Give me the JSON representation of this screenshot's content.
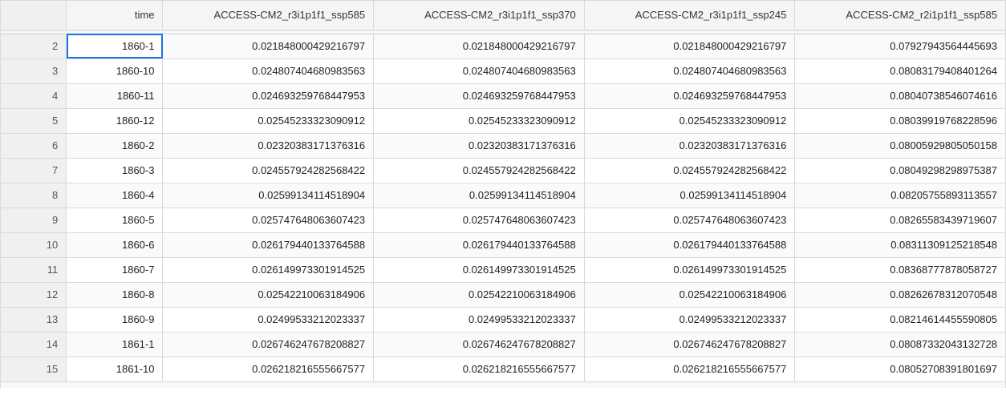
{
  "columns": {
    "rownum": "",
    "time": "time",
    "c1": "ACCESS-CM2_r3i1p1f1_ssp585",
    "c2": "ACCESS-CM2_r3i1p1f1_ssp370",
    "c3": "ACCESS-CM2_r3i1p1f1_ssp245",
    "c4": "ACCESS-CM2_r2i1p1f1_ssp585"
  },
  "selected_cell": {
    "row_index": 0,
    "col": "time"
  },
  "rows": [
    {
      "rownum": "2",
      "time": "1860-1",
      "c1": "0.021848000429216797",
      "c2": "0.021848000429216797",
      "c3": "0.021848000429216797",
      "c4": "0.07927943564445693"
    },
    {
      "rownum": "3",
      "time": "1860-10",
      "c1": "0.024807404680983563",
      "c2": "0.024807404680983563",
      "c3": "0.024807404680983563",
      "c4": "0.08083179408401264"
    },
    {
      "rownum": "4",
      "time": "1860-11",
      "c1": "0.024693259768447953",
      "c2": "0.024693259768447953",
      "c3": "0.024693259768447953",
      "c4": "0.08040738546074616"
    },
    {
      "rownum": "5",
      "time": "1860-12",
      "c1": "0.02545233323090912",
      "c2": "0.02545233323090912",
      "c3": "0.02545233323090912",
      "c4": "0.08039919768228596"
    },
    {
      "rownum": "6",
      "time": "1860-2",
      "c1": "0.02320383171376316",
      "c2": "0.02320383171376316",
      "c3": "0.02320383171376316",
      "c4": "0.08005929805050158"
    },
    {
      "rownum": "7",
      "time": "1860-3",
      "c1": "0.024557924282568422",
      "c2": "0.024557924282568422",
      "c3": "0.024557924282568422",
      "c4": "0.08049298298975387"
    },
    {
      "rownum": "8",
      "time": "1860-4",
      "c1": "0.02599134114518904",
      "c2": "0.02599134114518904",
      "c3": "0.02599134114518904",
      "c4": "0.08205755893113557"
    },
    {
      "rownum": "9",
      "time": "1860-5",
      "c1": "0.025747648063607423",
      "c2": "0.025747648063607423",
      "c3": "0.025747648063607423",
      "c4": "0.08265583439719607"
    },
    {
      "rownum": "10",
      "time": "1860-6",
      "c1": "0.026179440133764588",
      "c2": "0.026179440133764588",
      "c3": "0.026179440133764588",
      "c4": "0.08311309125218548"
    },
    {
      "rownum": "11",
      "time": "1860-7",
      "c1": "0.026149973301914525",
      "c2": "0.026149973301914525",
      "c3": "0.026149973301914525",
      "c4": "0.08368777878058727"
    },
    {
      "rownum": "12",
      "time": "1860-8",
      "c1": "0.02542210063184906",
      "c2": "0.02542210063184906",
      "c3": "0.02542210063184906",
      "c4": "0.08262678312070548"
    },
    {
      "rownum": "13",
      "time": "1860-9",
      "c1": "0.02499533212023337",
      "c2": "0.02499533212023337",
      "c3": "0.02499533212023337",
      "c4": "0.08214614455590805"
    },
    {
      "rownum": "14",
      "time": "1861-1",
      "c1": "0.026746247678208827",
      "c2": "0.026746247678208827",
      "c3": "0.026746247678208827",
      "c4": "0.08087332043132728"
    },
    {
      "rownum": "15",
      "time": "1861-10",
      "c1": "0.026218216555667577",
      "c2": "0.026218216555667577",
      "c3": "0.026218216555667577",
      "c4": "0.08052708391801697"
    }
  ]
}
